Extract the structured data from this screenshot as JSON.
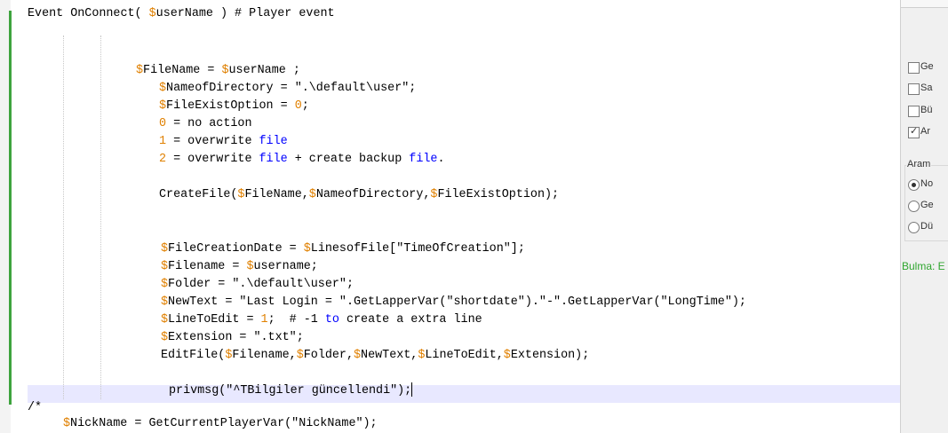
{
  "editor": {
    "lines": [
      {
        "segs": [
          [
            "Event OnConnect( ",
            "s"
          ],
          [
            "$",
            "sig"
          ],
          [
            "userName ) # Player event",
            "s"
          ]
        ]
      },
      {
        "segs": []
      },
      {
        "segs": []
      },
      {
        "segs": [
          [
            "$",
            "sig"
          ],
          [
            "FileName = ",
            "s"
          ],
          [
            "$",
            "sig"
          ],
          [
            "userName ;",
            "s"
          ]
        ]
      },
      {
        "segs": [
          [
            "$",
            "sig"
          ],
          [
            "NameofDirectory = \".\\default\\user\";",
            "s"
          ]
        ]
      },
      {
        "segs": [
          [
            "$",
            "sig"
          ],
          [
            "FileExistOption = ",
            "s"
          ],
          [
            "0",
            "n"
          ],
          [
            ";",
            "s"
          ]
        ]
      },
      {
        "segs": [
          [
            "0",
            "n"
          ],
          [
            " = no action",
            "s"
          ]
        ]
      },
      {
        "segs": [
          [
            "1",
            "n"
          ],
          [
            " = overwrite ",
            "s"
          ],
          [
            "file",
            "kw"
          ]
        ]
      },
      {
        "segs": [
          [
            "2",
            "n"
          ],
          [
            " = overwrite ",
            "s"
          ],
          [
            "file",
            "kw"
          ],
          [
            " + create backup ",
            "s"
          ],
          [
            "file",
            "kw"
          ],
          [
            ".",
            "s"
          ]
        ]
      },
      {
        "segs": []
      },
      {
        "segs": [
          [
            "CreateFile(",
            "s"
          ],
          [
            "$",
            "sig"
          ],
          [
            "FileName,",
            "s"
          ],
          [
            "$",
            "sig"
          ],
          [
            "NameofDirectory,",
            "s"
          ],
          [
            "$",
            "sig"
          ],
          [
            "FileExistOption);",
            "s"
          ]
        ]
      },
      {
        "segs": []
      },
      {
        "segs": []
      },
      {
        "segs": [
          [
            "$",
            "sig"
          ],
          [
            "FileCreationDate = ",
            "s"
          ],
          [
            "$",
            "sig"
          ],
          [
            "LinesofFile[\"TimeOfCreation\"];",
            "s"
          ]
        ]
      },
      {
        "segs": [
          [
            "$",
            "sig"
          ],
          [
            "Filename = ",
            "s"
          ],
          [
            "$",
            "sig"
          ],
          [
            "username;",
            "s"
          ]
        ]
      },
      {
        "segs": [
          [
            "$",
            "sig"
          ],
          [
            "Folder = \".\\default\\user\";",
            "s"
          ]
        ]
      },
      {
        "segs": [
          [
            "$",
            "sig"
          ],
          [
            "NewText = \"Last Login = \".GetLapperVar(\"shortdate\").\"-\".GetLapperVar(\"LongTime\");",
            "s"
          ]
        ]
      },
      {
        "segs": [
          [
            "$",
            "sig"
          ],
          [
            "LineToEdit = ",
            "s"
          ],
          [
            "1",
            "n"
          ],
          [
            ";  # -1 ",
            "s"
          ],
          [
            "to",
            "kw"
          ],
          [
            " create a extra line",
            "s"
          ]
        ]
      },
      {
        "segs": [
          [
            "$",
            "sig"
          ],
          [
            "Extension = \".txt\";",
            "s"
          ]
        ]
      },
      {
        "segs": [
          [
            "EditFile(",
            "s"
          ],
          [
            "$",
            "sig"
          ],
          [
            "Filename,",
            "s"
          ],
          [
            "$",
            "sig"
          ],
          [
            "Folder,",
            "s"
          ],
          [
            "$",
            "sig"
          ],
          [
            "NewText,",
            "s"
          ],
          [
            "$",
            "sig"
          ],
          [
            "LineToEdit,",
            "s"
          ],
          [
            "$",
            "sig"
          ],
          [
            "Extension);",
            "s"
          ]
        ]
      },
      {
        "segs": []
      },
      {
        "segs": [
          [
            "privmsg(\"^TBilgiler güncellendi\");",
            "s"
          ]
        ]
      },
      {
        "segs": [
          [
            "/*",
            "s"
          ]
        ]
      },
      {
        "segs": [
          [
            "$",
            "sig"
          ],
          [
            "NickName = GetCurrentPlayerVar(\"NickName\");",
            "s"
          ]
        ]
      }
    ]
  },
  "panel": {
    "checkboxes": [
      {
        "label": "Ge",
        "checked": false
      },
      {
        "label": "Sa",
        "checked": false
      },
      {
        "label": "Bü",
        "checked": false
      },
      {
        "label": "Ar",
        "checked": true
      }
    ],
    "group_label": "Aram",
    "radios": [
      {
        "label": "No",
        "selected": true
      },
      {
        "label": "Ge",
        "selected": false
      },
      {
        "label": "Dü",
        "selected": false
      }
    ],
    "status": "Bulma: E"
  },
  "colors": {
    "changebar": "#3ea33e",
    "variable": "#e08000",
    "keyword": "#0000ff",
    "status": "#2fa62f"
  }
}
